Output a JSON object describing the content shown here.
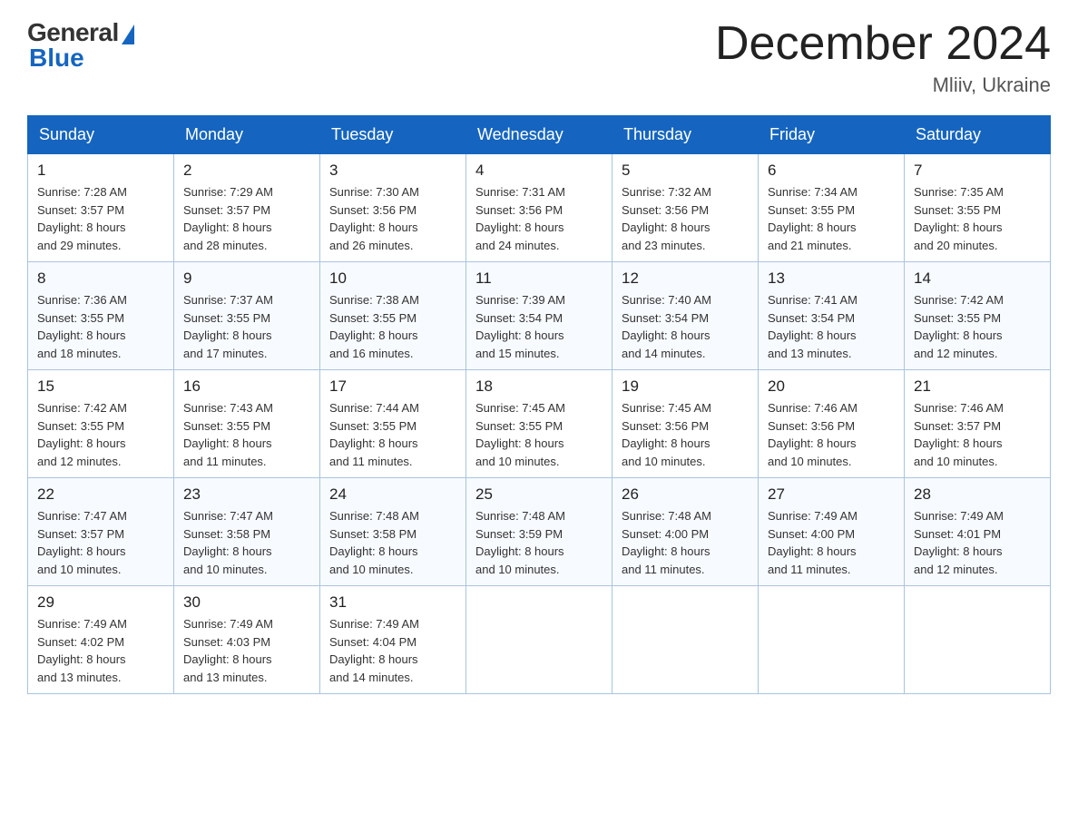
{
  "header": {
    "logo_general": "General",
    "logo_blue": "Blue",
    "month_title": "December 2024",
    "location": "Mliiv, Ukraine"
  },
  "days_of_week": [
    "Sunday",
    "Monday",
    "Tuesday",
    "Wednesday",
    "Thursday",
    "Friday",
    "Saturday"
  ],
  "weeks": [
    [
      {
        "day": "1",
        "info": "Sunrise: 7:28 AM\nSunset: 3:57 PM\nDaylight: 8 hours\nand 29 minutes."
      },
      {
        "day": "2",
        "info": "Sunrise: 7:29 AM\nSunset: 3:57 PM\nDaylight: 8 hours\nand 28 minutes."
      },
      {
        "day": "3",
        "info": "Sunrise: 7:30 AM\nSunset: 3:56 PM\nDaylight: 8 hours\nand 26 minutes."
      },
      {
        "day": "4",
        "info": "Sunrise: 7:31 AM\nSunset: 3:56 PM\nDaylight: 8 hours\nand 24 minutes."
      },
      {
        "day": "5",
        "info": "Sunrise: 7:32 AM\nSunset: 3:56 PM\nDaylight: 8 hours\nand 23 minutes."
      },
      {
        "day": "6",
        "info": "Sunrise: 7:34 AM\nSunset: 3:55 PM\nDaylight: 8 hours\nand 21 minutes."
      },
      {
        "day": "7",
        "info": "Sunrise: 7:35 AM\nSunset: 3:55 PM\nDaylight: 8 hours\nand 20 minutes."
      }
    ],
    [
      {
        "day": "8",
        "info": "Sunrise: 7:36 AM\nSunset: 3:55 PM\nDaylight: 8 hours\nand 18 minutes."
      },
      {
        "day": "9",
        "info": "Sunrise: 7:37 AM\nSunset: 3:55 PM\nDaylight: 8 hours\nand 17 minutes."
      },
      {
        "day": "10",
        "info": "Sunrise: 7:38 AM\nSunset: 3:55 PM\nDaylight: 8 hours\nand 16 minutes."
      },
      {
        "day": "11",
        "info": "Sunrise: 7:39 AM\nSunset: 3:54 PM\nDaylight: 8 hours\nand 15 minutes."
      },
      {
        "day": "12",
        "info": "Sunrise: 7:40 AM\nSunset: 3:54 PM\nDaylight: 8 hours\nand 14 minutes."
      },
      {
        "day": "13",
        "info": "Sunrise: 7:41 AM\nSunset: 3:54 PM\nDaylight: 8 hours\nand 13 minutes."
      },
      {
        "day": "14",
        "info": "Sunrise: 7:42 AM\nSunset: 3:55 PM\nDaylight: 8 hours\nand 12 minutes."
      }
    ],
    [
      {
        "day": "15",
        "info": "Sunrise: 7:42 AM\nSunset: 3:55 PM\nDaylight: 8 hours\nand 12 minutes."
      },
      {
        "day": "16",
        "info": "Sunrise: 7:43 AM\nSunset: 3:55 PM\nDaylight: 8 hours\nand 11 minutes."
      },
      {
        "day": "17",
        "info": "Sunrise: 7:44 AM\nSunset: 3:55 PM\nDaylight: 8 hours\nand 11 minutes."
      },
      {
        "day": "18",
        "info": "Sunrise: 7:45 AM\nSunset: 3:55 PM\nDaylight: 8 hours\nand 10 minutes."
      },
      {
        "day": "19",
        "info": "Sunrise: 7:45 AM\nSunset: 3:56 PM\nDaylight: 8 hours\nand 10 minutes."
      },
      {
        "day": "20",
        "info": "Sunrise: 7:46 AM\nSunset: 3:56 PM\nDaylight: 8 hours\nand 10 minutes."
      },
      {
        "day": "21",
        "info": "Sunrise: 7:46 AM\nSunset: 3:57 PM\nDaylight: 8 hours\nand 10 minutes."
      }
    ],
    [
      {
        "day": "22",
        "info": "Sunrise: 7:47 AM\nSunset: 3:57 PM\nDaylight: 8 hours\nand 10 minutes."
      },
      {
        "day": "23",
        "info": "Sunrise: 7:47 AM\nSunset: 3:58 PM\nDaylight: 8 hours\nand 10 minutes."
      },
      {
        "day": "24",
        "info": "Sunrise: 7:48 AM\nSunset: 3:58 PM\nDaylight: 8 hours\nand 10 minutes."
      },
      {
        "day": "25",
        "info": "Sunrise: 7:48 AM\nSunset: 3:59 PM\nDaylight: 8 hours\nand 10 minutes."
      },
      {
        "day": "26",
        "info": "Sunrise: 7:48 AM\nSunset: 4:00 PM\nDaylight: 8 hours\nand 11 minutes."
      },
      {
        "day": "27",
        "info": "Sunrise: 7:49 AM\nSunset: 4:00 PM\nDaylight: 8 hours\nand 11 minutes."
      },
      {
        "day": "28",
        "info": "Sunrise: 7:49 AM\nSunset: 4:01 PM\nDaylight: 8 hours\nand 12 minutes."
      }
    ],
    [
      {
        "day": "29",
        "info": "Sunrise: 7:49 AM\nSunset: 4:02 PM\nDaylight: 8 hours\nand 13 minutes."
      },
      {
        "day": "30",
        "info": "Sunrise: 7:49 AM\nSunset: 4:03 PM\nDaylight: 8 hours\nand 13 minutes."
      },
      {
        "day": "31",
        "info": "Sunrise: 7:49 AM\nSunset: 4:04 PM\nDaylight: 8 hours\nand 14 minutes."
      },
      {
        "day": "",
        "info": ""
      },
      {
        "day": "",
        "info": ""
      },
      {
        "day": "",
        "info": ""
      },
      {
        "day": "",
        "info": ""
      }
    ]
  ]
}
